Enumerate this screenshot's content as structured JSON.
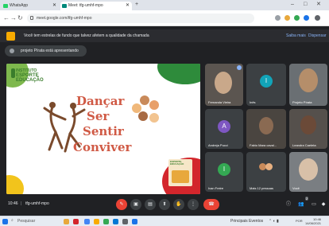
{
  "browser": {
    "tabs": [
      {
        "title": "WhatsApp"
      },
      {
        "title": "Meet: tfg-umhf-mpo"
      }
    ],
    "new_tab": "+",
    "address": "meet.google.com/tfg-umhf-mpo",
    "window_controls": [
      "–",
      "□",
      "✕"
    ]
  },
  "meet": {
    "banner": {
      "text": "Você tem estrelas de fundo que talvez afetem a qualidade da chamada",
      "action1": "Saiba mais",
      "action2": "Dispensar"
    },
    "notification": "projeto Pírata está apresentando",
    "slide": {
      "logo_line1": "INSTITUTO",
      "logo_line2": "ESPORTE",
      "logo_line3": "EDUCAÇÃO",
      "words": [
        "Dançar",
        "Ser",
        "Sentir",
        "Conviver"
      ],
      "small_logo": "ESPORTE EDUCAÇÃO"
    },
    "participants": [
      {
        "name": "Fernanda Vieira",
        "type": "video"
      },
      {
        "name": "Inês",
        "type": "avatar",
        "initial": "I",
        "color": "#12a4b8"
      },
      {
        "name": "Projeto Pírata",
        "type": "video"
      },
      {
        "name": "Andreja Pucci",
        "type": "avatar",
        "initial": "A",
        "color": "#7e57c2"
      },
      {
        "name": "Fabio Mara caval...",
        "type": "video"
      },
      {
        "name": "Leandra Caeleta",
        "type": "video"
      },
      {
        "name": "Ivan Freire",
        "type": "avatar",
        "initial": "I",
        "color": "#34a853"
      },
      {
        "name": "Mais 12 pessoas",
        "type": "group"
      },
      {
        "name": "Você",
        "type": "video"
      }
    ],
    "bottom": {
      "time": "10:46",
      "separator": "|",
      "meeting_code": "tfg-umhf-mpo",
      "participant_count": "2"
    }
  },
  "taskbar": {
    "search_placeholder": "Pesquisar",
    "right_text": "Principais Eventos",
    "clock_time": "10:46",
    "clock_date": "14/06/2021",
    "language": "POR"
  },
  "colors": {
    "meet_bg": "#202124",
    "tile_bg": "#3c4043",
    "end_call": "#ea4335",
    "slide_title": "#d05a45"
  }
}
